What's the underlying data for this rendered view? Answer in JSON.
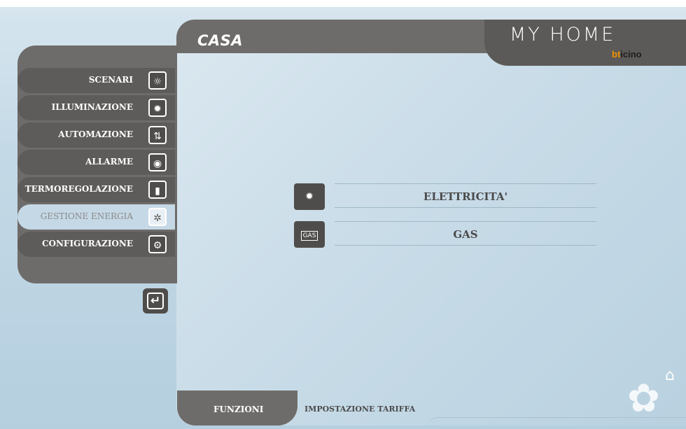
{
  "header": {
    "title": "CASA",
    "brand": "MY HOME",
    "logo": {
      "b": "bt",
      "rest": "icino"
    }
  },
  "sidebar": {
    "items": [
      {
        "label": "SCENARI",
        "icon": "scenario-icon",
        "active": false
      },
      {
        "label": "ILLUMINAZIONE",
        "icon": "bulb-icon",
        "active": false
      },
      {
        "label": "AUTOMAZIONE",
        "icon": "shutter-icon",
        "active": false
      },
      {
        "label": "ALLARME",
        "icon": "alarm-icon",
        "active": false
      },
      {
        "label": "TERMOREGOLAZIONE",
        "icon": "thermometer-icon",
        "active": false
      },
      {
        "label": "GESTIONE ENERGIA",
        "icon": "energy-gear-icon",
        "active": true
      },
      {
        "label": "CONFIGURAZIONE",
        "icon": "gear-icon",
        "active": false
      }
    ],
    "back": {
      "icon": "back-arrow-icon"
    }
  },
  "options": [
    {
      "label": "ELETTRICITA'",
      "icon": "plug-bulb-icon"
    },
    {
      "label": "GAS",
      "icon": "gas-meter-icon",
      "icon_text": "GAS"
    }
  ],
  "footer": {
    "tab_functions": "FUNZIONI",
    "tab_tariff": "IMPOSTAZIONE TARIFFA"
  },
  "colors": {
    "panel_dark": "#6e6c6a",
    "active": "#c5d8e5",
    "accent_logo": "#f39200"
  }
}
